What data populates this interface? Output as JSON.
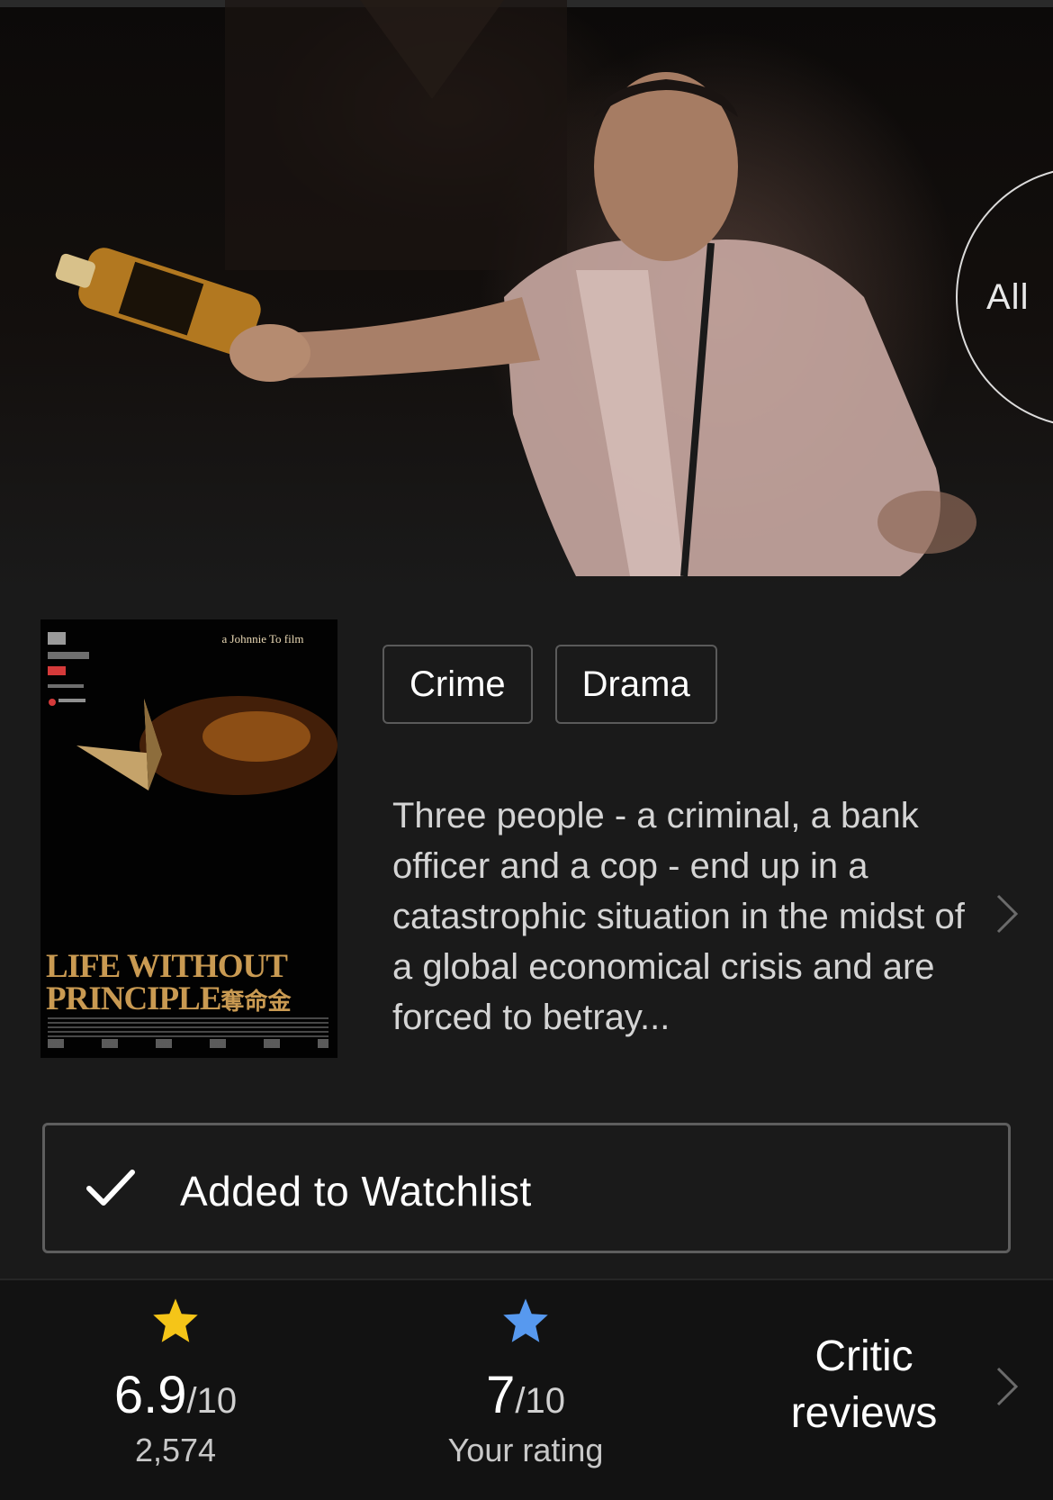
{
  "hero": {
    "gallery_label": "All"
  },
  "poster": {
    "credit": "a Johnnie To film",
    "title_line1": "LIFE WITHOUT",
    "title_line2": "PRINCIPLE",
    "title_cn": "奪命金"
  },
  "genres": [
    "Crime",
    "Drama"
  ],
  "plot": "Three people - a criminal, a bank officer and a cop - end up in a catastrophic situation in the midst of a global economical crisis and are forced to betray...",
  "watchlist": {
    "label": "Added to Watchlist"
  },
  "ratings": {
    "imdb": {
      "score": "6.9",
      "max": "/10",
      "votes": "2,574",
      "star_color": "#f5c518"
    },
    "user": {
      "score": "7",
      "max": "/10",
      "label": "Your rating",
      "star_color": "#5799ef"
    },
    "critic": {
      "line1": "Critic",
      "line2": "reviews"
    }
  }
}
